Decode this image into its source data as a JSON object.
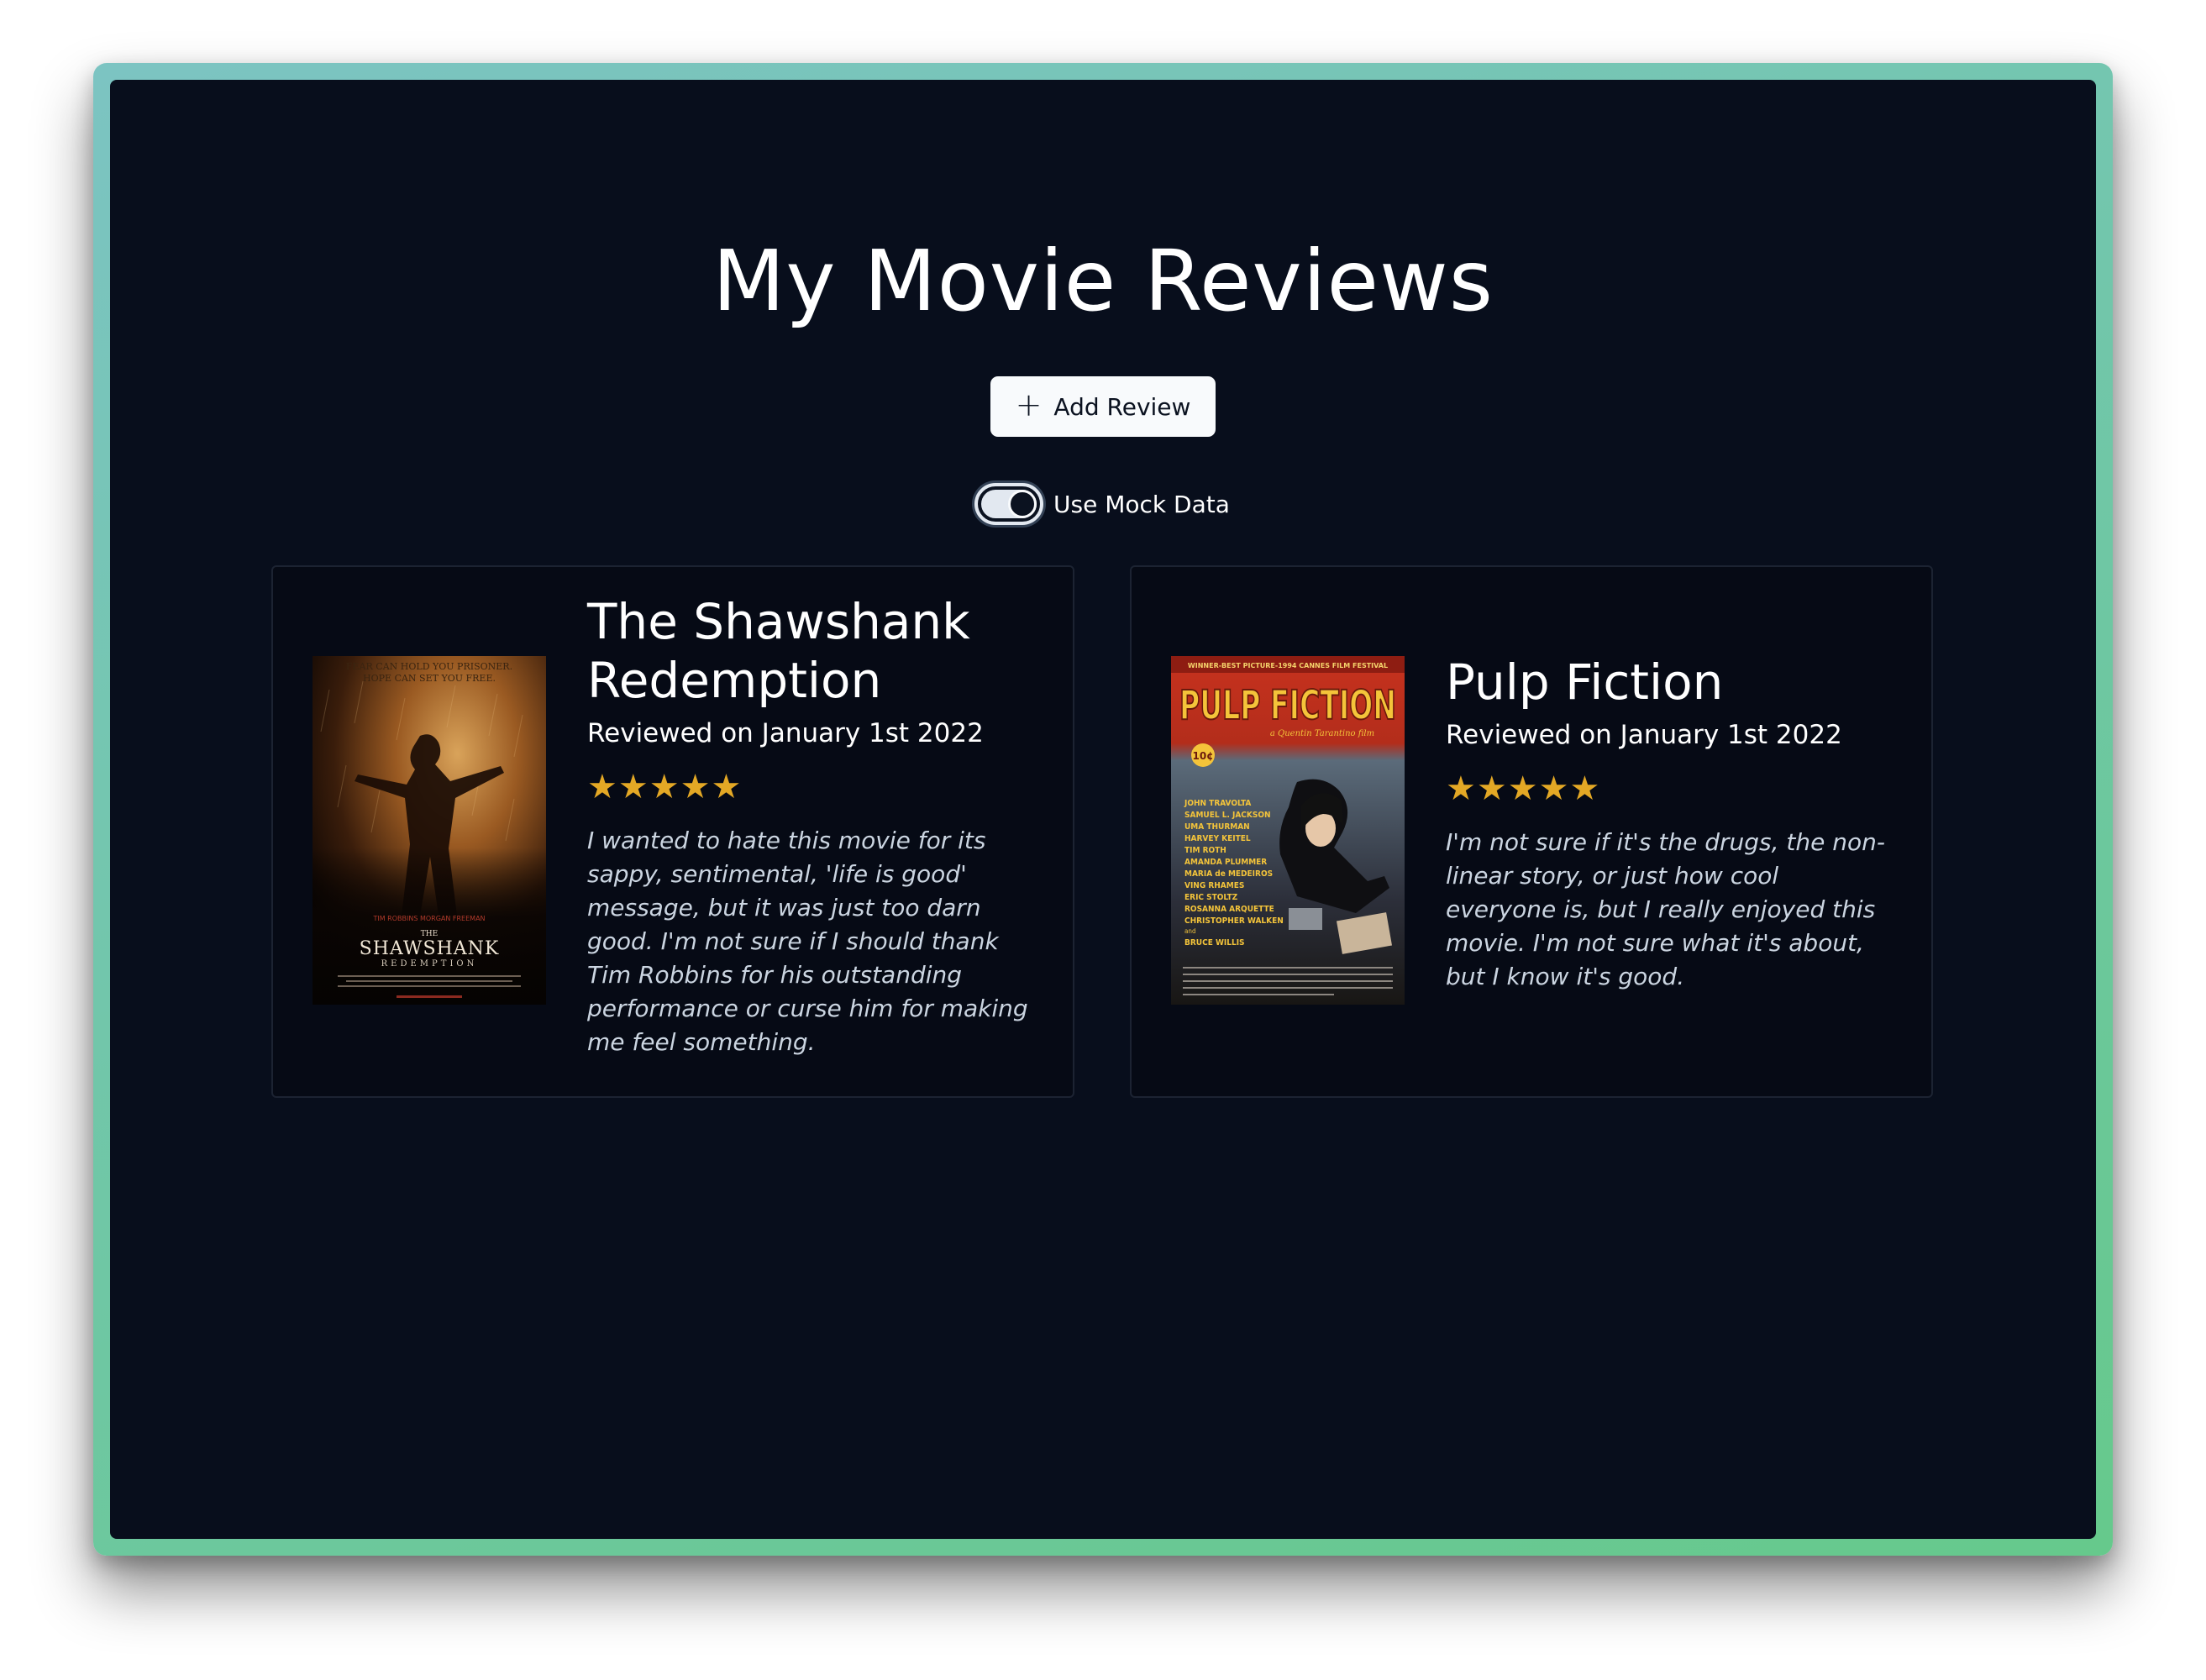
{
  "page": {
    "title": "My Movie Reviews"
  },
  "actions": {
    "add_review_label": "Add Review"
  },
  "toggle": {
    "label": "Use Mock Data",
    "checked": true
  },
  "reviews": [
    {
      "title": "The Shawshank Redemption",
      "reviewed": "Reviewed on January 1st 2022",
      "rating": 5,
      "stars": "★★★★★",
      "text": "I wanted to hate this movie for its sappy, sentimental, 'life is good' message, but it was just too darn good. I'm not sure if I should thank Tim Robbins for his outstanding performance or curse him for making me feel something."
    },
    {
      "title": "Pulp Fiction",
      "reviewed": "Reviewed on January 1st 2022",
      "rating": 5,
      "stars": "★★★★★",
      "text": "I'm not sure if it's the drugs, the non-linear story, or just how cool everyone is, but I really enjoyed this movie. I'm not sure what it's about, but I know it's good."
    }
  ],
  "posters": {
    "shawshank": {
      "tagline_1": "FEAR CAN HOLD YOU PRISONER.",
      "tagline_2": "HOPE CAN SET YOU FREE.",
      "actors": "TIM ROBBINS    MORGAN FREEMAN",
      "the": "THE",
      "name": "SHAWSHANK",
      "subname": "REDEMPTION"
    },
    "pulp": {
      "top_banner": "WINNER-BEST PICTURE-1994 CANNES FILM FESTIVAL",
      "name": "PULP FICTION",
      "byline": "a Quentin Tarantino film",
      "price": "10¢",
      "cast": [
        "JOHN TRAVOLTA",
        "SAMUEL L. JACKSON",
        "UMA THURMAN",
        "HARVEY KEITEL",
        "TIM ROTH",
        "AMANDA PLUMMER",
        "MARIA de MEDEIROS",
        "VING RHAMES",
        "ERIC STOLTZ",
        "ROSANNA ARQUETTE",
        "CHRISTOPHER WALKEN",
        "and",
        "BRUCE WILLIS"
      ]
    }
  },
  "colors": {
    "background": "#080e1c",
    "card": "#060a15",
    "star": "#e3a825",
    "frame_gradient_start": "#7cc4c2",
    "frame_gradient_end": "#66c98c"
  }
}
